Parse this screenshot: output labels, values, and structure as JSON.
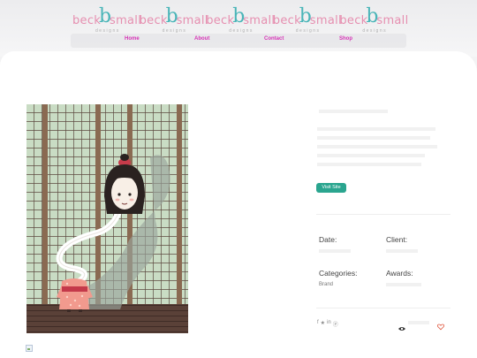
{
  "brand": {
    "word_left": "beck",
    "word_right": "small",
    "b_glyph": "b",
    "subtitle": "designs"
  },
  "nav": {
    "items": [
      {
        "label": "Home"
      },
      {
        "label": "About"
      },
      {
        "label": "Contact"
      },
      {
        "label": "Shop"
      }
    ]
  },
  "project": {
    "visit_label": "Visit Site",
    "date_label": "Date:",
    "client_label": "Client:",
    "categories_label": "Categories:",
    "categories_value": "Brand",
    "awards_label": "Awards:"
  },
  "share": {
    "icons": [
      "facebook-icon",
      "twitter-icon",
      "linkedin-icon",
      "pinterest-icon"
    ],
    "glyphs": [
      "f",
      "★",
      "in",
      "ⓟ"
    ]
  },
  "colors": {
    "nav_link": "#d633b6",
    "logo_pink": "#e68fb0",
    "logo_teal": "#4ab5b8",
    "button": "#2aa58f",
    "heart": "#e0573e"
  }
}
